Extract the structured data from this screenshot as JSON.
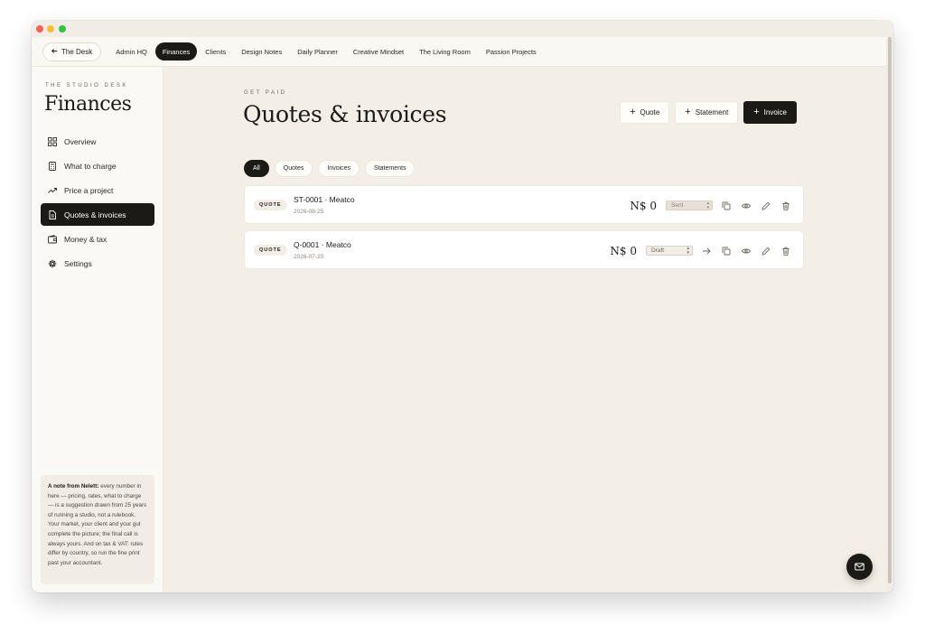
{
  "nav": {
    "back_label": "The Desk",
    "items": [
      {
        "label": "Admin HQ"
      },
      {
        "label": "Finances"
      },
      {
        "label": "Clients"
      },
      {
        "label": "Design Notes"
      },
      {
        "label": "Daily Planner"
      },
      {
        "label": "Creative Mindset"
      },
      {
        "label": "The Living Room"
      },
      {
        "label": "Passion Projects"
      }
    ],
    "active": "Finances"
  },
  "sidebar": {
    "eyebrow": "THE STUDIO DESK",
    "title": "Finances",
    "items": [
      {
        "label": "Overview",
        "icon": "grid-icon"
      },
      {
        "label": "What to charge",
        "icon": "calculator-icon"
      },
      {
        "label": "Price a project",
        "icon": "trend-up-icon"
      },
      {
        "label": "Quotes & invoices",
        "icon": "document-icon"
      },
      {
        "label": "Money & tax",
        "icon": "wallet-icon"
      },
      {
        "label": "Settings",
        "icon": "gear-icon"
      }
    ],
    "active": "Quotes & invoices",
    "note": {
      "heading": "A note from Nelett:",
      "body": " every number in here — pricing, rates, what to charge — is a suggestion drawn from 25 years of running a studio, not a rulebook. Your market, your client and your gut complete the picture; the final call is always yours. And on tax & VAT: rules differ by country, so run the fine print past your accountant."
    }
  },
  "main": {
    "eyebrow": "GET PAID",
    "title": "Quotes & invoices",
    "actions": {
      "quote": "Quote",
      "statement": "Statement",
      "invoice": "Invoice"
    },
    "filters": [
      "All",
      "Quotes",
      "Invoices",
      "Statements"
    ],
    "active_filter": "All",
    "documents": [
      {
        "type": "QUOTE",
        "title": "ST-0001 · Meatco",
        "date": "2026-08-25",
        "amount": "N$ 0",
        "status": "Sent",
        "has_convert": false
      },
      {
        "type": "QUOTE",
        "title": "Q-0001 · Meatco",
        "date": "2026-07-20",
        "amount": "N$ 0",
        "status": "Draft",
        "has_convert": true
      }
    ]
  },
  "colors": {
    "accent": "#1c1a17",
    "background": "#f4efe6",
    "sidebar": "#fbf9f5"
  }
}
